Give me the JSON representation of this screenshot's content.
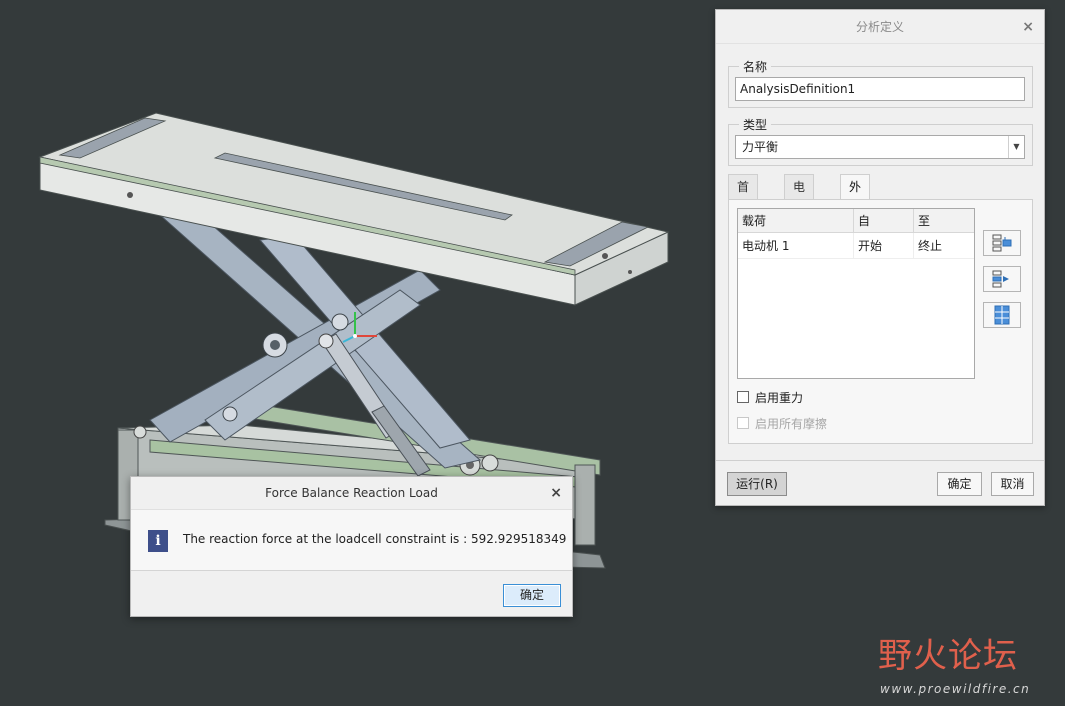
{
  "analysis_dialog": {
    "title": "分析定义",
    "close": "×",
    "name_group": {
      "label": "名称",
      "value": "AnalysisDefinition1"
    },
    "type_group": {
      "label": "类型",
      "selected": "力平衡"
    },
    "tabs": [
      {
        "label": "首选项",
        "active": false
      },
      {
        "label": "电动机",
        "active": false
      },
      {
        "label": "外部载荷",
        "active": true
      }
    ],
    "loads_table": {
      "columns": [
        "载荷",
        "自",
        "至"
      ],
      "rows": [
        {
          "load": "电动机 1",
          "from": "开始",
          "to": "终止"
        }
      ]
    },
    "side_buttons": [
      {
        "icon": "insert-row-icon"
      },
      {
        "icon": "move-row-icon"
      },
      {
        "icon": "table-grid-icon"
      }
    ],
    "checkboxes": [
      {
        "label": "启用重力",
        "checked": false,
        "enabled": true
      },
      {
        "label": "启用所有摩擦",
        "checked": false,
        "enabled": false
      }
    ],
    "run_button": "运行(R)",
    "ok_button": "确定",
    "cancel_button": "取消"
  },
  "message_dialog": {
    "title": "Force Balance Reaction Load",
    "close": "×",
    "icon": "info-icon",
    "icon_glyph": "i",
    "text": "The reaction force at the loadcell constraint is : 592.929518349",
    "ok_button": "确定"
  },
  "watermark": {
    "brand": "野火论坛",
    "url": "www.proewildfire.cn"
  },
  "colors": {
    "viewport_bg": "#343a3b",
    "accent_blue": "#3a8fd6",
    "watermark_red": "#e0604c"
  }
}
